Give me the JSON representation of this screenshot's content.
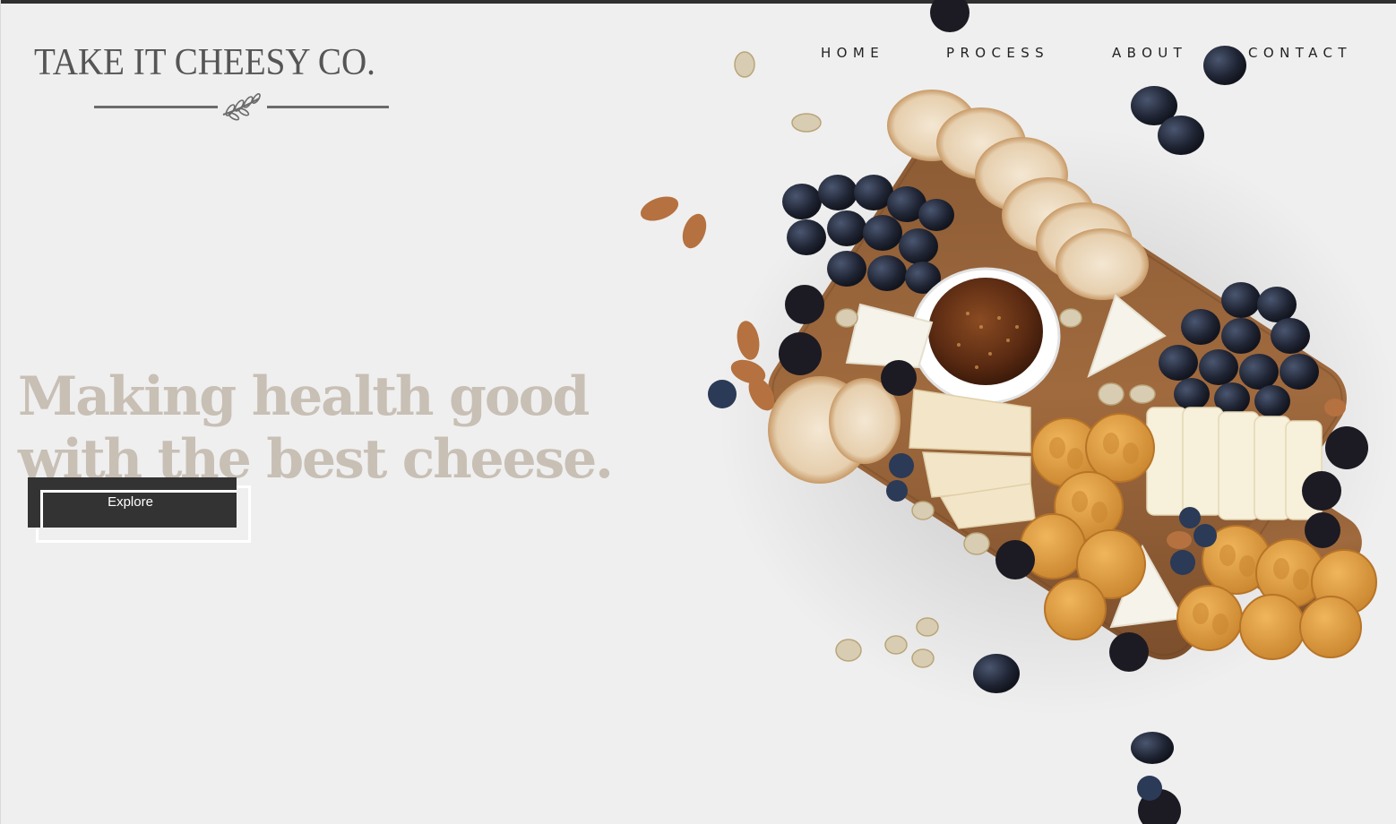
{
  "brand": {
    "name": "TAKE IT CHEESY CO.",
    "text_color": "#555555"
  },
  "nav": {
    "items": [
      {
        "label": "HOME"
      },
      {
        "label": "PROCESS"
      },
      {
        "label": "ABOUT"
      },
      {
        "label": "CONTACT"
      }
    ]
  },
  "hero": {
    "headline_line1": "Making health good",
    "headline_line2": "with the best cheese.",
    "headline_color": "#c8bfb5",
    "cta_label": "Explore",
    "cta_color": "#333333",
    "image_icon": "charcuterie-board-illustration"
  },
  "colors": {
    "background": "#efefef",
    "text_dark": "#222222"
  }
}
